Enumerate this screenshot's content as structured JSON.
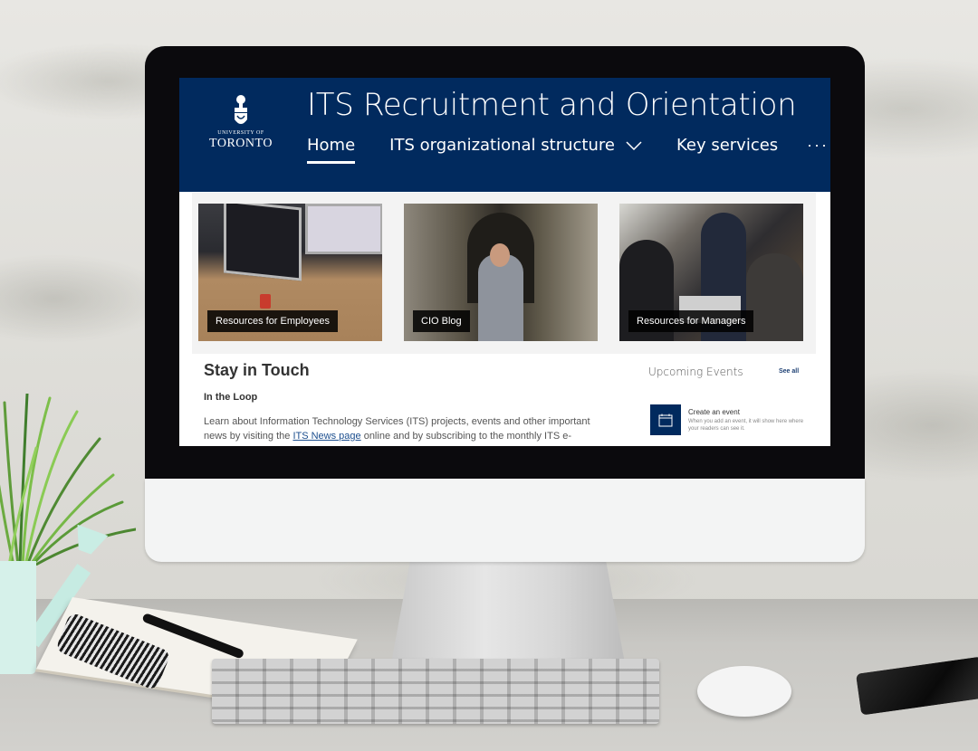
{
  "site": {
    "logo": {
      "university_line": "UNIVERSITY OF",
      "name_line": "TORONTO"
    },
    "title": "ITS Recruitment and Orientation",
    "nav": {
      "items": [
        {
          "label": "Home",
          "active": true,
          "has_dropdown": false
        },
        {
          "label": "ITS organizational structure",
          "active": false,
          "has_dropdown": true
        },
        {
          "label": "Key services",
          "active": false,
          "has_dropdown": false
        }
      ],
      "more_label": "···"
    },
    "colors": {
      "header_bg": "#012a5e",
      "link": "#1c4f8f"
    }
  },
  "hero_tiles": [
    {
      "label": "Resources for Employees",
      "image": "desk-with-monitors-photo"
    },
    {
      "label": "CIO Blog",
      "image": "man-in-corridor-photo"
    },
    {
      "label": "Resources for Managers",
      "image": "team-meeting-photo"
    }
  ],
  "stay_in_touch": {
    "title": "Stay in Touch",
    "subtitle": "In the Loop",
    "text_before_link": "Learn about Information Technology Services (ITS) projects, events and other important news by visiting the ",
    "link_text": "ITS News page",
    "text_after_link": " online and by subscribing to the monthly ITS e-"
  },
  "events": {
    "title": "Upcoming Events",
    "see_all": "See all",
    "empty_state": {
      "icon": "calendar-icon",
      "title": "Create an event",
      "description": "When you add an event, it will show here where your readers can see it."
    }
  }
}
